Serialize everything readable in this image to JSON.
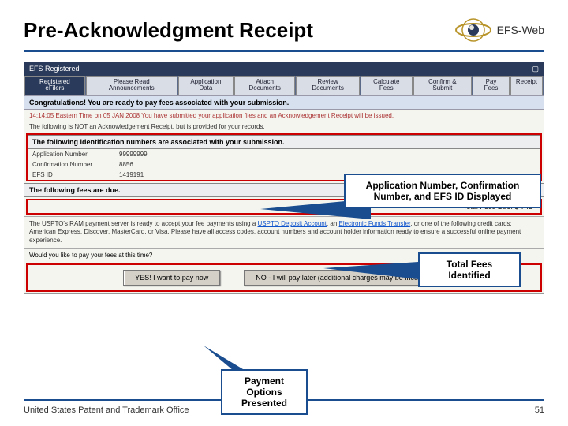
{
  "header": {
    "title": "Pre-Acknowledgment Receipt",
    "logo_text": "EFS-Web"
  },
  "app": {
    "topbar_left": "EFS Registered",
    "topbar_right_icon": "minimize-restore",
    "tabs": [
      {
        "label": "Registered\neFilers"
      },
      {
        "label": "Please Read\nAnnouncements"
      },
      {
        "label": "Application\nData"
      },
      {
        "label": "Attach\nDocuments"
      },
      {
        "label": "Review\nDocuments"
      },
      {
        "label": "Calculate\nFees"
      },
      {
        "label": "Confirm &\nSubmit"
      },
      {
        "label": "Pay\nFees"
      },
      {
        "label": "Receipt"
      }
    ],
    "congrats": "Congratulations! You are ready to pay fees associated with your submission.",
    "timeline": "14:14:05 Eastern Time on 05 JAN 2008 You have submitted your application files and an Acknowledgement Receipt will be issued.",
    "notice": "The following is NOT an Acknowledgement Receipt, but is provided for your records.",
    "ids_head": "The following identification numbers are associated with your submission.",
    "ids": {
      "app_num_label": "Application Number",
      "app_num_value": "99999999",
      "conf_num_label": "Confirmation Number",
      "conf_num_value": "8856",
      "efs_id_label": "EFS ID",
      "efs_id_value": "1419191"
    },
    "fees_head": "The following fees are due.",
    "fees_due_label": "Total Fees Due: $",
    "fees_due_value": "745",
    "pay_text_1": "The USPTO's RAM payment server is ready to accept your fee payments using a ",
    "pay_link_1": "USPTO Deposit Account",
    "pay_text_2": ", an ",
    "pay_link_2": "Electronic Funds Transfer",
    "pay_text_3": ", or one of the following credit cards: American Express, Discover, MasterCard, or Visa. Please have all access codes, account numbers and account holder information ready to ensure a successful online payment experience.",
    "pay_prompt": "Would you like to pay your fees at this time?",
    "btn_yes": "YES! I want to pay now",
    "btn_no": "NO - I will pay later (additional charges may be incurred)"
  },
  "callouts": {
    "ids_callout": "Application Number, Confirmation Number, and EFS ID Displayed",
    "fees_callout": "Total Fees Identified",
    "pay_callout": "Payment Options Presented"
  },
  "footer": {
    "left": "United States Patent and Trademark Office",
    "page": "51"
  }
}
